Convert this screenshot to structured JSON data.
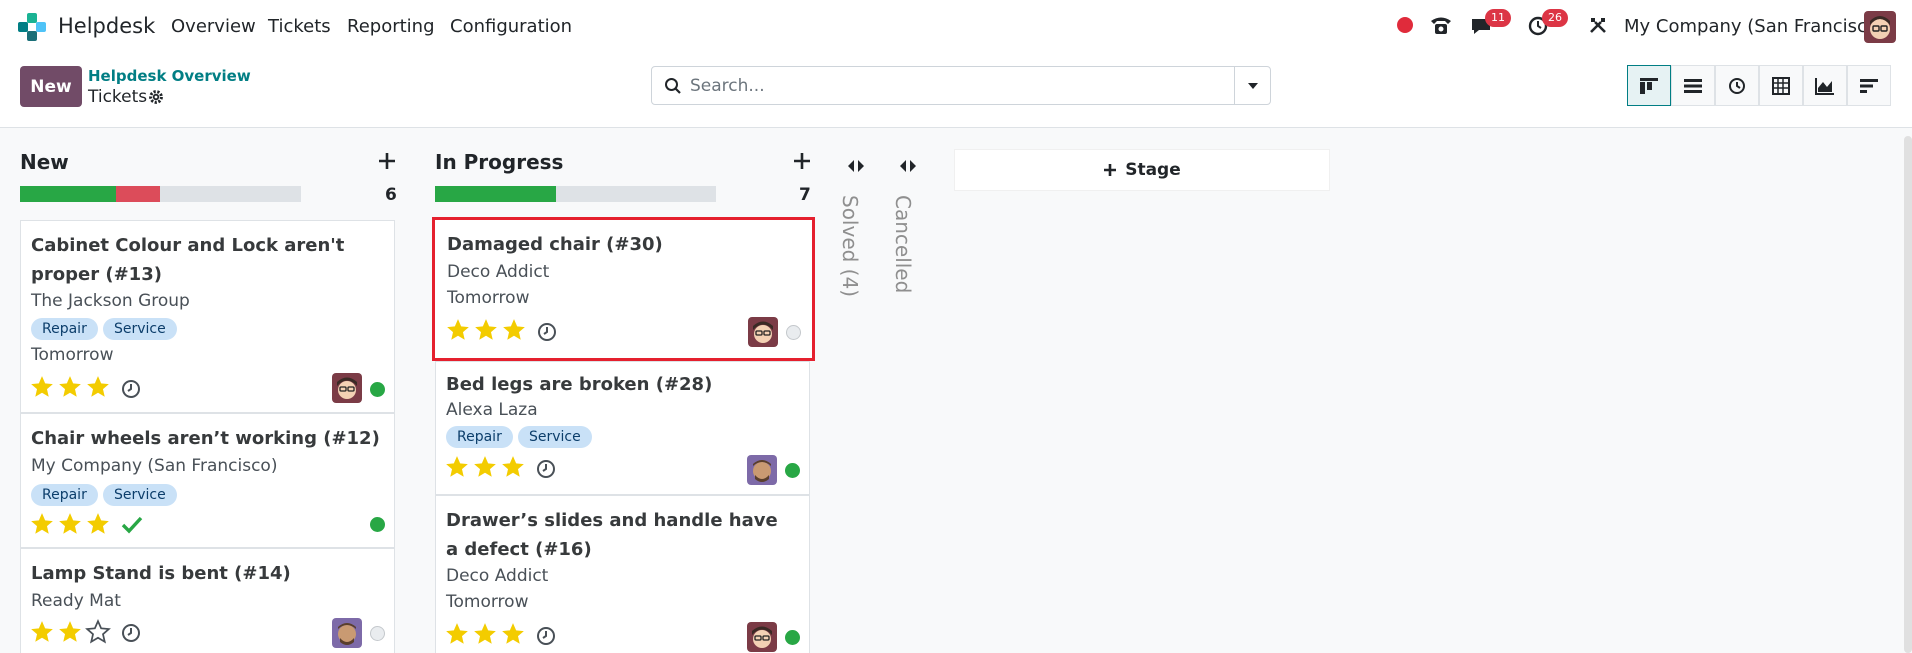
{
  "nav": {
    "app_name": "Helpdesk",
    "menu": [
      "Overview",
      "Tickets",
      "Reporting",
      "Configuration"
    ],
    "messages_count": "11",
    "activities_count": "26",
    "company": "My Company (San Francisco)"
  },
  "control": {
    "new_label": "New",
    "breadcrumb_parent": "Helpdesk Overview",
    "breadcrumb_current": "Tickets",
    "search_placeholder": "Search...",
    "views": [
      "kanban-icon",
      "list-icon",
      "activity-icon",
      "pivot-icon",
      "graph-icon",
      "cohort-icon"
    ]
  },
  "colors": {
    "brand": "#714B67",
    "link": "#017e84",
    "progress_green": "#28a745",
    "progress_red": "#dc4c5a",
    "star": "#f3cc00",
    "highlight": "#e5202e"
  },
  "columns": [
    {
      "title": "New",
      "count": "6",
      "progress": {
        "green": 0.34,
        "red": 0.16
      },
      "cards": [
        {
          "title": "Cabinet Colour and Lock aren't proper (#13)",
          "partner": "The Jackson Group",
          "tags": [
            "Repair",
            "Service"
          ],
          "date": "Tomorrow",
          "stars": 3,
          "activity": "clock",
          "status": "green"
        },
        {
          "title": "Chair wheels aren’t working (#12)",
          "partner": "My Company (San Francisco)",
          "tags": [
            "Repair",
            "Service"
          ],
          "date": "",
          "stars": 3,
          "activity": "check",
          "status": "green"
        },
        {
          "title": "Lamp Stand is bent (#14)",
          "partner": "Ready Mat",
          "tags": [],
          "date": "",
          "stars": 2,
          "activity": "clock",
          "status": "grey"
        }
      ]
    },
    {
      "title": "In Progress",
      "count": "7",
      "progress": {
        "green": 0.43,
        "red": 0
      },
      "cards": [
        {
          "title": "Damaged chair (#30)",
          "partner": "Deco Addict",
          "tags": [],
          "date": "Tomorrow",
          "stars": 3,
          "activity": "clock",
          "status": "grey"
        },
        {
          "title": "Bed legs are broken (#28)",
          "partner": "Alexa Laza",
          "tags": [
            "Repair",
            "Service"
          ],
          "date": "",
          "stars": 3,
          "activity": "clock",
          "status": "green"
        },
        {
          "title": "Drawer’s slides and handle have a defect (#16)",
          "partner": "Deco Addict",
          "tags": [],
          "date": "Tomorrow",
          "stars": 3,
          "activity": "clock",
          "status": "green"
        }
      ]
    }
  ],
  "folded": [
    {
      "label": "Solved (4)"
    },
    {
      "label": "Cancelled"
    }
  ],
  "add_stage_label": "Stage"
}
